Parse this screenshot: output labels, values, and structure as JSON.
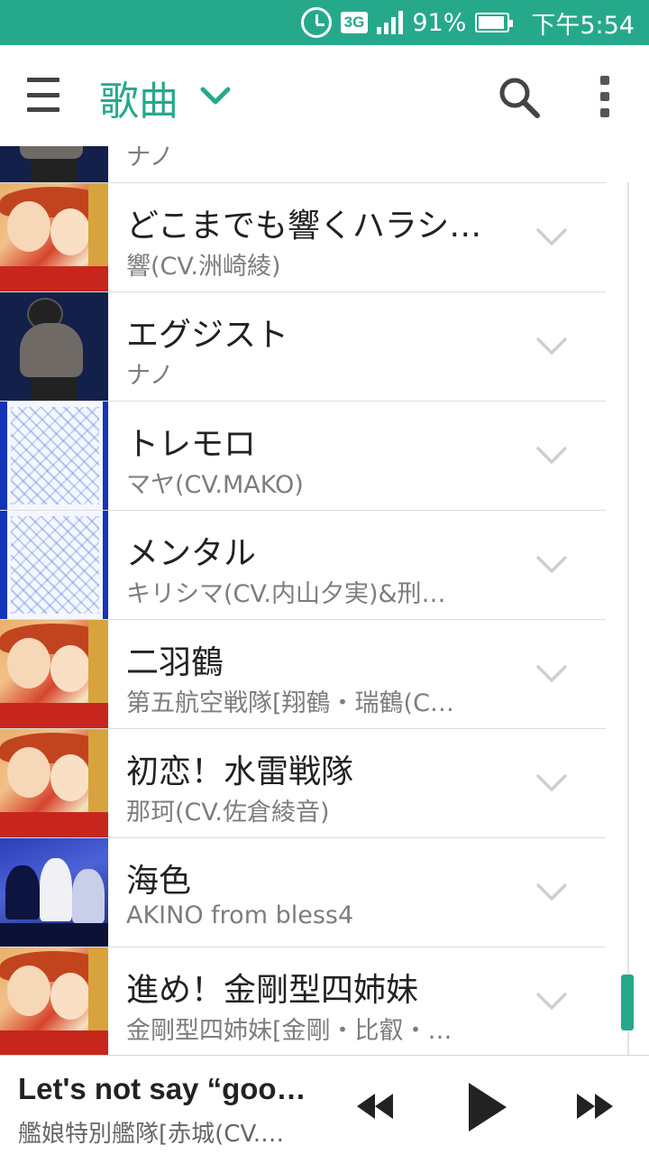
{
  "status_bar": {
    "network": "3G",
    "battery": "91%",
    "battery_level": 0.91,
    "time": "下午5:54",
    "icons": [
      "alarm-icon",
      "signal-icon",
      "battery-icon"
    ]
  },
  "app_bar": {
    "title": "歌曲",
    "icons": [
      "menu-icon",
      "chevron-down-icon",
      "search-icon",
      "more-vert-icon"
    ]
  },
  "accent_color": "#26a98b",
  "songs": [
    {
      "title": "",
      "artist": "ナノ",
      "art": "rock"
    },
    {
      "title": "どこまでも響くハラシ…",
      "artist": "響(CV.洲崎綾)",
      "art": "kancolle"
    },
    {
      "title": "エグジスト",
      "artist": "ナノ",
      "art": "rock"
    },
    {
      "title": "トレモロ",
      "artist": "マヤ(CV.MAKO)",
      "art": "sketch"
    },
    {
      "title": "メンタル",
      "artist": "キリシマ(CV.内山夕実)&刑…",
      "art": "sketch"
    },
    {
      "title": "二羽鶴",
      "artist": "第五航空戦隊[翔鶴・瑞鶴(C…",
      "art": "kancolle"
    },
    {
      "title": "初恋！水雷戦隊",
      "artist": "那珂(CV.佐倉綾音)",
      "art": "kancolle"
    },
    {
      "title": "海色",
      "artist": "AKINO from bless4",
      "art": "sea"
    },
    {
      "title": "進め！金剛型四姉妹",
      "artist": "金剛型四姉妹[金剛・比叡・…",
      "art": "kancolle"
    }
  ],
  "now_playing": {
    "title": "Let's not say “goo…",
    "artist": "艦娘特別艦隊[赤城(CV.…",
    "controls": [
      "rewind-icon",
      "play-icon",
      "fast-forward-icon"
    ]
  }
}
